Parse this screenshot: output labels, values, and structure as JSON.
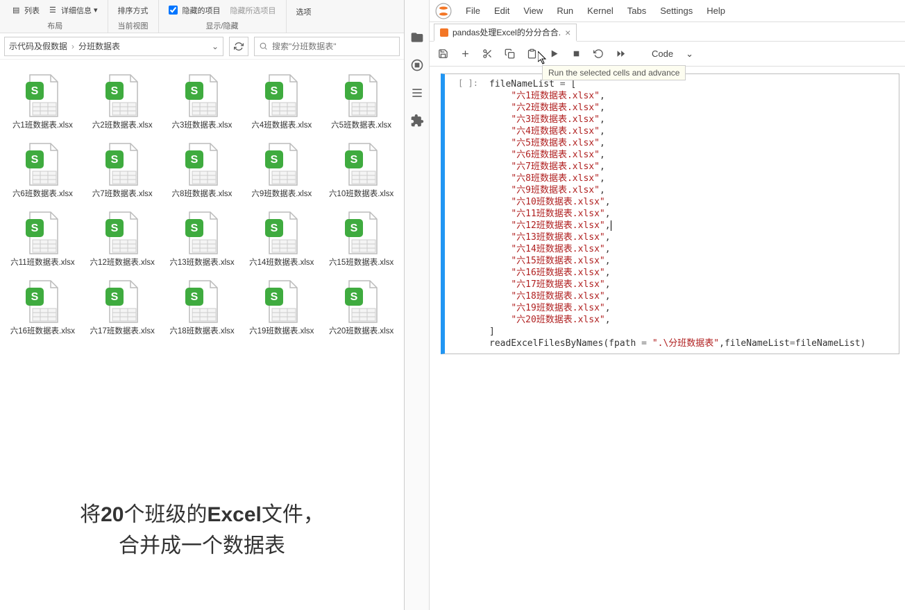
{
  "explorer": {
    "ribbon": {
      "list_btn": "列表",
      "details_btn": "详细信息",
      "sort_btn": "排序方式",
      "hidden_items": "隐藏的项目",
      "hide_selected": "隐藏所选项目",
      "options": "选项",
      "group_layout": "布局",
      "group_view": "当前视图",
      "group_show": "显示/隐藏"
    },
    "breadcrumb": {
      "part1": "示代码及假数据",
      "part2": "分班数据表"
    },
    "search_placeholder": "搜索\"分班数据表\"",
    "files": [
      "六1班数据表.xlsx",
      "六2班数据表.xlsx",
      "六3班数据表.xlsx",
      "六4班数据表.xlsx",
      "六5班数据表.xlsx",
      "六6班数据表.xlsx",
      "六7班数据表.xlsx",
      "六8班数据表.xlsx",
      "六9班数据表.xlsx",
      "六10班数据表.xlsx",
      "六11班数据表.xlsx",
      "六12班数据表.xlsx",
      "六13班数据表.xlsx",
      "六14班数据表.xlsx",
      "六15班数据表.xlsx",
      "六16班数据表.xlsx",
      "六17班数据表.xlsx",
      "六18班数据表.xlsx",
      "六19班数据表.xlsx",
      "六20班数据表.xlsx"
    ],
    "caption_line1_a": "将",
    "caption_line1_b": "20",
    "caption_line1_c": "个班级的",
    "caption_line1_d": "Excel",
    "caption_line1_e": "文件，",
    "caption_line2": "合并成一个数据表"
  },
  "jupyter": {
    "menus": [
      "File",
      "Edit",
      "View",
      "Run",
      "Kernel",
      "Tabs",
      "Settings",
      "Help"
    ],
    "tab_title": "pandas处理Excel的分分合合.",
    "tooltip": "Run the selected cells and advance",
    "celltype": "Code",
    "prompt": "[ ]:",
    "code": {
      "line1_a": "fileNameList ",
      "line1_b": "=",
      "line1_c": " [",
      "strings": [
        "\"六1班数据表.xlsx\"",
        "\"六2班数据表.xlsx\"",
        "\"六3班数据表.xlsx\"",
        "\"六4班数据表.xlsx\"",
        "\"六5班数据表.xlsx\"",
        "\"六6班数据表.xlsx\"",
        "\"六7班数据表.xlsx\"",
        "\"六8班数据表.xlsx\"",
        "\"六9班数据表.xlsx\"",
        "\"六10班数据表.xlsx\"",
        "\"六11班数据表.xlsx\"",
        "\"六12班数据表.xlsx\"",
        "\"六13班数据表.xlsx\"",
        "\"六14班数据表.xlsx\"",
        "\"六15班数据表.xlsx\"",
        "\"六16班数据表.xlsx\"",
        "\"六17班数据表.xlsx\"",
        "\"六18班数据表.xlsx\"",
        "\"六19班数据表.xlsx\"",
        "\"六20班数据表.xlsx\""
      ],
      "close_bracket": "]",
      "call_a": "readExcelFilesByNames(fpath ",
      "call_b": "=",
      "call_c": " ",
      "call_path": "\".\\分班数据表\"",
      "call_d": ",fileNameList",
      "call_e": "=",
      "call_f": "fileNameList)"
    }
  }
}
